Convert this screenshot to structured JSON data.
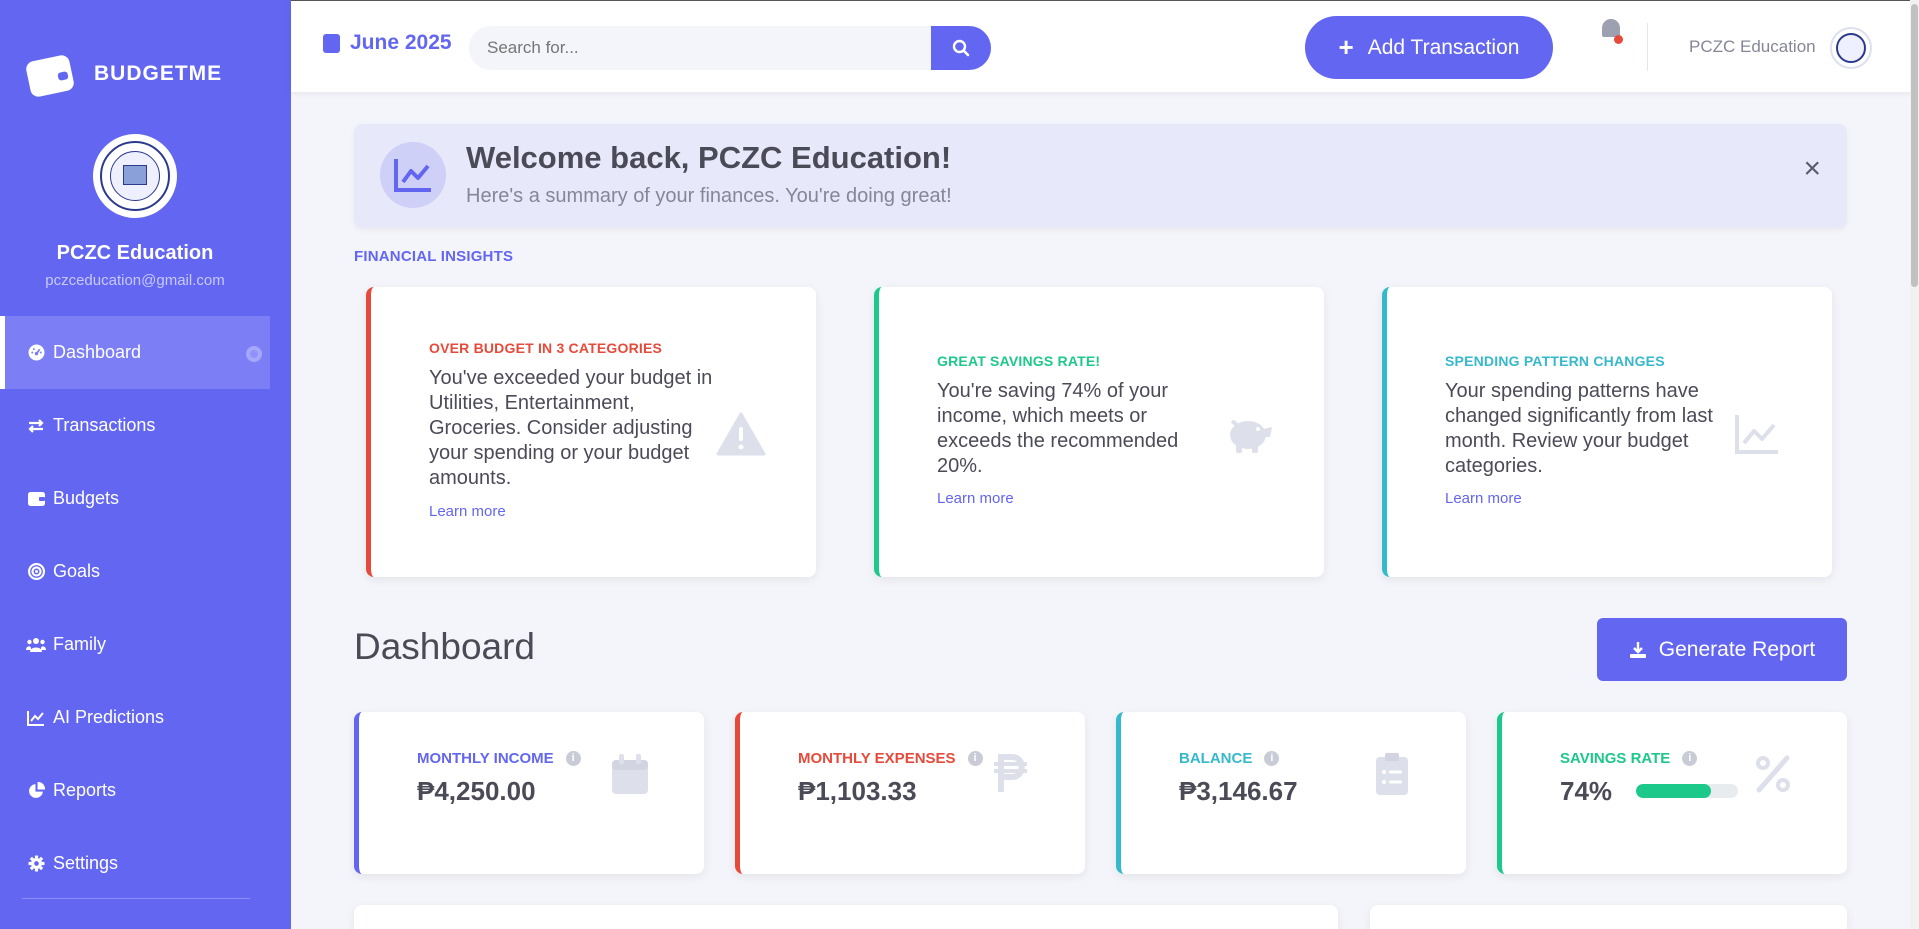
{
  "colors": {
    "primary": "#6366f1",
    "danger": "#e74a3b",
    "success": "#1cc88a",
    "info": "#36b9cc",
    "muted_icon": "#dddfeb"
  },
  "sidebar": {
    "brand": "BUDGETME",
    "user_name": "PCZC Education",
    "user_email": "pczceducation@gmail.com",
    "items": [
      {
        "label": "Dashboard",
        "icon": "gauge-icon",
        "active": true
      },
      {
        "label": "Transactions",
        "icon": "exchange-icon"
      },
      {
        "label": "Budgets",
        "icon": "wallet-icon"
      },
      {
        "label": "Goals",
        "icon": "target-icon"
      },
      {
        "label": "Family",
        "icon": "users-icon"
      },
      {
        "label": "AI Predictions",
        "icon": "chart-line-icon"
      },
      {
        "label": "Reports",
        "icon": "pie-chart-icon"
      },
      {
        "label": "Settings",
        "icon": "gear-icon"
      }
    ]
  },
  "topbar": {
    "date": "June 2025",
    "search_placeholder": "Search for...",
    "add_transaction": "Add Transaction",
    "user_name": "PCZC Education"
  },
  "welcome": {
    "title": "Welcome back, PCZC Education!",
    "subtitle": "Here's a summary of your finances. You're doing great!"
  },
  "insights": {
    "section_label": "FINANCIAL INSIGHTS",
    "cards": [
      {
        "kicker": "OVER BUDGET IN 3 CATEGORIES",
        "text": "You've exceeded your budget in Utilities, Entertainment, Groceries. Consider adjusting your spending or your budget amounts.",
        "link": "Learn more",
        "icon": "warning-icon",
        "color": "#e74a3b"
      },
      {
        "kicker": "GREAT SAVINGS RATE!",
        "text": "You're saving 74% of your income, which meets or exceeds the recommended 20%.",
        "link": "Learn more",
        "icon": "piggy-bank-icon",
        "color": "#1cc88a"
      },
      {
        "kicker": "SPENDING PATTERN CHANGES",
        "text": "Your spending patterns have changed significantly from last month. Review your budget categories.",
        "link": "Learn more",
        "icon": "chart-line-icon",
        "color": "#36b9cc"
      }
    ]
  },
  "dashboard": {
    "title": "Dashboard",
    "generate_report": "Generate Report",
    "stats": [
      {
        "label": "MONTHLY INCOME",
        "value": "₱4,250.00",
        "icon": "calendar-icon",
        "color": "#6366f1"
      },
      {
        "label": "MONTHLY EXPENSES",
        "value": "₱1,103.33",
        "icon": "peso-icon",
        "color": "#e74a3b"
      },
      {
        "label": "BALANCE",
        "value": "₱3,146.67",
        "icon": "clipboard-icon",
        "color": "#36b9cc"
      },
      {
        "label": "SAVINGS RATE",
        "value": "74%",
        "icon": "percent-icon",
        "color": "#1cc88a",
        "progress": 0.74
      }
    ]
  }
}
